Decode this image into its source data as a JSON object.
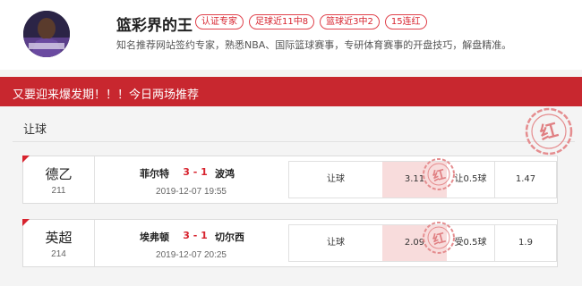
{
  "profile": {
    "name": "篮彩界的王",
    "badges": [
      "认证专家",
      "足球近11中8",
      "篮球近3中2",
      "15连红"
    ],
    "description": "知名推荐网站签约专家，熟悉NBA、国际篮球赛事，专研体育赛事的开盘技巧，解盘精准。"
  },
  "banner": {
    "text": "又要迎来爆发期！！！今日两场推荐"
  },
  "section": {
    "title": "让球"
  },
  "stamp_char": "红",
  "matches": [
    {
      "league": "德乙",
      "league_num": "211",
      "home": "菲尔特",
      "score": "3 - 1",
      "away": "波鸿",
      "time": "2019-12-07 19:55",
      "odds": {
        "type": "让球",
        "value": "3.11",
        "handicap": "让0.5球",
        "value2": "1.47"
      }
    },
    {
      "league": "英超",
      "league_num": "214",
      "home": "埃弗顿",
      "score": "3 - 1",
      "away": "切尔西",
      "time": "2019-12-07 20:25",
      "odds": {
        "type": "让球",
        "value": "2.09",
        "handicap": "受0.5球",
        "value2": "1.9"
      }
    }
  ],
  "colors": {
    "accent": "#d7232e",
    "banner": "#c8272f",
    "highlight": "#f8dcdc"
  }
}
